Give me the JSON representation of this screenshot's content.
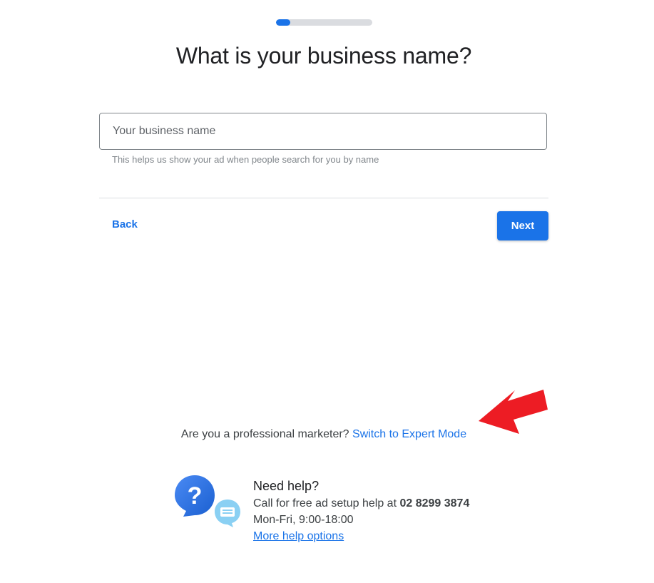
{
  "progress": {
    "value": 0.15,
    "color": "#1a73e8",
    "track_color": "#dadce0"
  },
  "title": "What is your business name?",
  "business_name_field": {
    "placeholder": "Your business name",
    "value": "",
    "helper": "This helps us show your ad when people search for you by name"
  },
  "nav": {
    "back_label": "Back",
    "next_label": "Next"
  },
  "expert_mode": {
    "prompt": "Are you a professional marketer?",
    "link_label": "Switch to Expert Mode"
  },
  "annotation": {
    "icon": "red-arrow-icon",
    "color": "#ed1c24"
  },
  "help": {
    "icon": "help-chat-bubbles-icon",
    "title": "Need help?",
    "call_text": "Call for free ad setup help at",
    "phone": "02 8299 3874",
    "hours": "Mon-Fri, 9:00-18:00",
    "more_label": "More help options"
  },
  "colors": {
    "accent": "#1a73e8",
    "text_primary": "#202124",
    "text_secondary": "#3c4043",
    "helper_text": "#80868b"
  }
}
